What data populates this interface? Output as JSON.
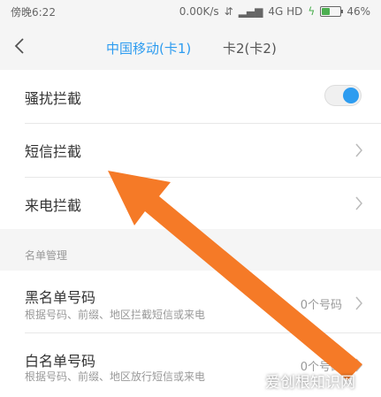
{
  "status_bar": {
    "time": "傍晚6:22",
    "speed": "0.00K/s",
    "network": "4G HD",
    "battery": "46%",
    "battery_level": 0.46
  },
  "header": {
    "tabs": [
      {
        "label": "中国移动(卡1)",
        "active": true
      },
      {
        "label": "卡2(卡2)",
        "active": false
      }
    ]
  },
  "settings": {
    "rows": [
      {
        "label": "骚扰拦截",
        "toggle_on": true
      },
      {
        "label": "短信拦截"
      },
      {
        "label": "来电拦截"
      }
    ]
  },
  "list_section": {
    "title": "名单管理",
    "items": [
      {
        "label": "黑名单号码",
        "subtitle": "根据号码、前缀、地区拦截短信或来电",
        "count": "0个号码"
      },
      {
        "label": "白名单号码",
        "subtitle": "根据号码、前缀、地区放行短信或来电",
        "count": "0个号码"
      }
    ]
  },
  "watermark": "爱创根知识网",
  "colors": {
    "accent": "#2d9cf0",
    "arrow": "#f57a27",
    "battery": "#4caf50"
  }
}
